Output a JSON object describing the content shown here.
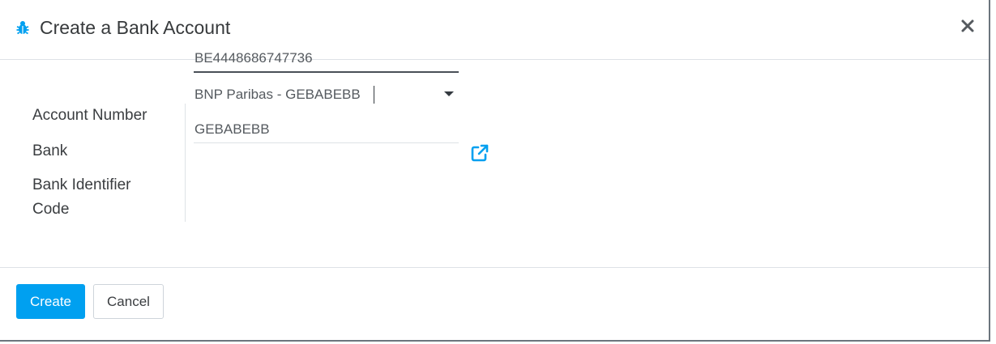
{
  "dialog": {
    "title": "Create a Bank Account",
    "accent_color": "#00a0f0"
  },
  "form": {
    "account_number": {
      "label": "Account Number",
      "value": "BE4448686747736"
    },
    "bank": {
      "label": "Bank",
      "value": "BNP Paribas - GEBABEBB"
    },
    "bic": {
      "label": "Bank Identifier Code",
      "value": "GEBABEBB"
    }
  },
  "footer": {
    "create_label": "Create",
    "cancel_label": "Cancel"
  },
  "icons": {
    "title": "bug-icon",
    "close": "close-icon",
    "bank_link": "external-link-icon",
    "bank_dropdown": "caret-down-icon"
  }
}
